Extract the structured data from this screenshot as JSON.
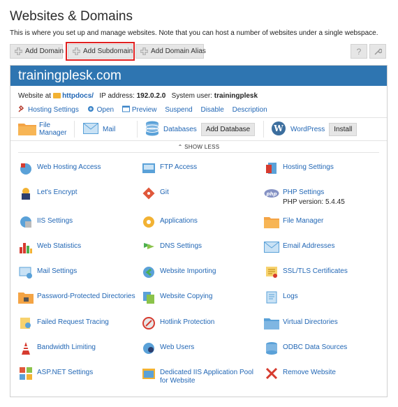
{
  "page": {
    "title": "Websites & Domains",
    "description": "This is where you set up and manage websites. Note that you can host a number of websites under a single webspace."
  },
  "toolbar": {
    "add_domain": "Add Domain",
    "add_subdomain": "Add Subdomain",
    "add_domain_alias": "Add Domain Alias",
    "help_icon": "?"
  },
  "domain": {
    "name": "trainingplesk.com",
    "website_at_label": "Website at",
    "docroot": "httpdocs/",
    "ip_label": "IP address:",
    "ip": "192.0.2.0",
    "user_label": "System user:",
    "user": "trainingplesk"
  },
  "links": [
    "Hosting Settings",
    "Open",
    "Preview",
    "Suspend",
    "Disable",
    "Description"
  ],
  "quick": {
    "file_manager_1": "File",
    "file_manager_2": "Manager",
    "mail": "Mail",
    "databases": "Databases",
    "add_database": "Add Database",
    "wordpress": "WordPress",
    "install": "Install"
  },
  "show_less": "SHOW LESS",
  "tools": [
    {
      "label": "Web Hosting Access",
      "icon": "web-hosting-access-icon"
    },
    {
      "label": "FTP Access",
      "icon": "ftp-access-icon"
    },
    {
      "label": "Hosting Settings",
      "icon": "hosting-settings-icon"
    },
    {
      "label": "Let's Encrypt",
      "icon": "lets-encrypt-icon"
    },
    {
      "label": "Git",
      "icon": "git-icon"
    },
    {
      "label": "PHP Settings",
      "icon": "php-icon",
      "sub": "PHP version: 5.4.45"
    },
    {
      "label": "IIS Settings",
      "icon": "iis-settings-icon"
    },
    {
      "label": "Applications",
      "icon": "applications-icon"
    },
    {
      "label": "File Manager",
      "icon": "file-manager-icon"
    },
    {
      "label": "Web Statistics",
      "icon": "web-statistics-icon"
    },
    {
      "label": "DNS Settings",
      "icon": "dns-settings-icon"
    },
    {
      "label": "Email Addresses",
      "icon": "email-addresses-icon"
    },
    {
      "label": "Mail Settings",
      "icon": "mail-settings-icon"
    },
    {
      "label": "Website Importing",
      "icon": "website-importing-icon"
    },
    {
      "label": "SSL/TLS Certificates",
      "icon": "ssl-certificates-icon"
    },
    {
      "label": "Password-Protected Directories",
      "icon": "password-directories-icon"
    },
    {
      "label": "Website Copying",
      "icon": "website-copying-icon"
    },
    {
      "label": "Logs",
      "icon": "logs-icon"
    },
    {
      "label": "Failed Request Tracing",
      "icon": "failed-request-tracing-icon"
    },
    {
      "label": "Hotlink Protection",
      "icon": "hotlink-protection-icon"
    },
    {
      "label": "Virtual Directories",
      "icon": "virtual-directories-icon"
    },
    {
      "label": "Bandwidth Limiting",
      "icon": "bandwidth-limiting-icon"
    },
    {
      "label": "Web Users",
      "icon": "web-users-icon"
    },
    {
      "label": "ODBC Data Sources",
      "icon": "odbc-data-sources-icon"
    },
    {
      "label": "ASP.NET Settings",
      "icon": "aspnet-settings-icon"
    },
    {
      "label": "Dedicated IIS Application Pool for Website",
      "icon": "iis-app-pool-icon"
    },
    {
      "label": "Remove Website",
      "icon": "remove-website-icon"
    }
  ]
}
